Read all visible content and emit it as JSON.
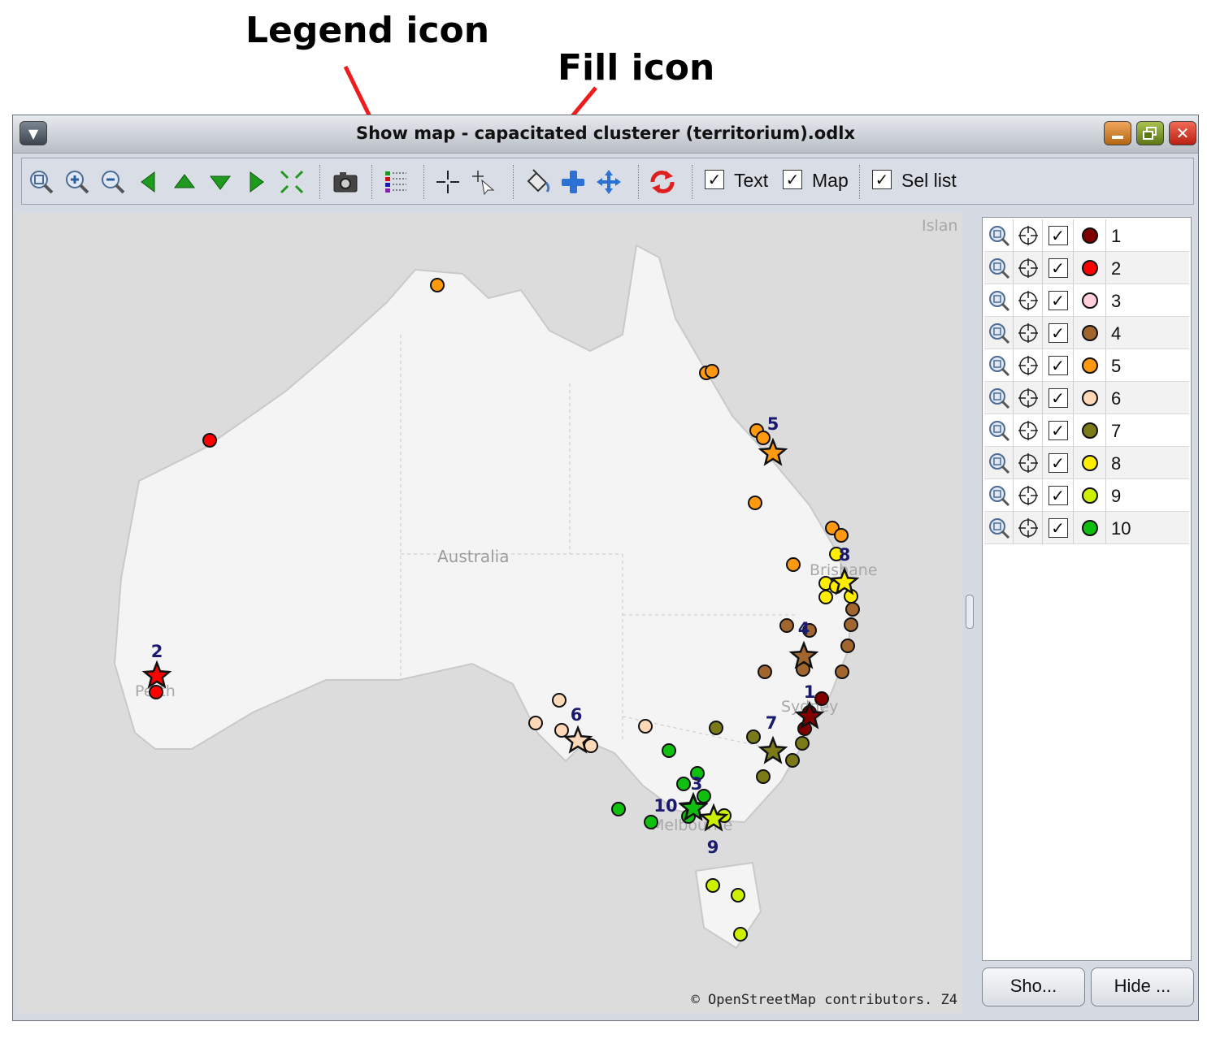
{
  "annotations": {
    "legend_icon": "Legend icon",
    "fill_icon": "Fill icon"
  },
  "window": {
    "title": "Show map - capacitated clusterer (territorium).odlx"
  },
  "toolbar": {
    "icons": [
      "zoom-fit-icon",
      "zoom-in-icon",
      "zoom-out-icon",
      "pan-left-icon",
      "pan-up-icon",
      "pan-down-icon",
      "pan-right-icon",
      "expand-icon",
      "camera-icon",
      "legend-icon",
      "select-crosshair-icon",
      "select-pointer-icon",
      "fill-icon",
      "add-icon",
      "move-icon",
      "refresh-icon"
    ],
    "checkboxes": [
      {
        "label": "Text",
        "checked": true
      },
      {
        "label": "Map",
        "checked": true
      },
      {
        "label": "Sel list",
        "checked": true
      }
    ]
  },
  "map": {
    "country_label": "Australia",
    "city_labels": [
      "Brisbane",
      "Perth",
      "Sydney",
      "Melbourne"
    ],
    "corner_label": "Islan",
    "attribution": "© OpenStreetMap contributors. Z4",
    "cluster_labels": [
      "1",
      "2",
      "3",
      "4",
      "5",
      "6",
      "7",
      "8",
      "9",
      "10"
    ]
  },
  "selection_list": {
    "rows": [
      {
        "label": "1",
        "color": "#800000",
        "checked": true
      },
      {
        "label": "2",
        "color": "#ff0000",
        "checked": true
      },
      {
        "label": "3",
        "color": "#ffd0dc",
        "checked": true
      },
      {
        "label": "4",
        "color": "#a0662e",
        "checked": true
      },
      {
        "label": "5",
        "color": "#ff9a10",
        "checked": true
      },
      {
        "label": "6",
        "color": "#ffd8b8",
        "checked": true
      },
      {
        "label": "7",
        "color": "#7a7a18",
        "checked": true
      },
      {
        "label": "8",
        "color": "#ffee00",
        "checked": true
      },
      {
        "label": "9",
        "color": "#ccf000",
        "checked": true
      },
      {
        "label": "10",
        "color": "#10c010",
        "checked": true
      }
    ],
    "show_button": "Sho...",
    "hide_button": "Hide ..."
  }
}
